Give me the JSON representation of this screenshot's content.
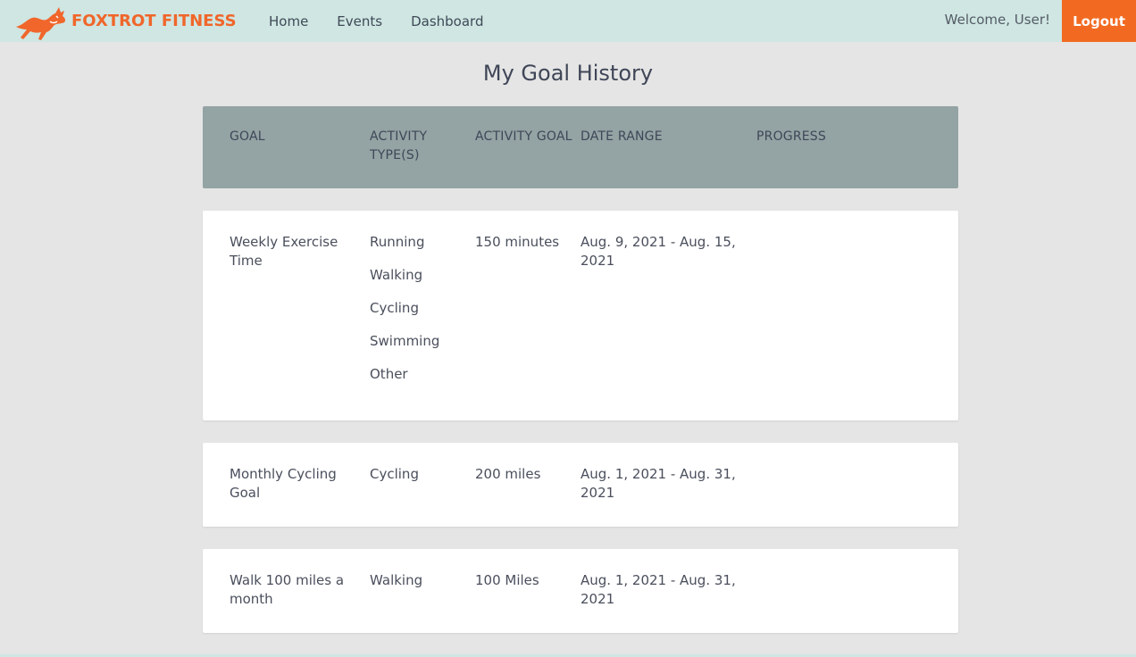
{
  "brand": {
    "name": "FOXTROT FITNESS",
    "logo": "fox-logo-icon",
    "color": "#f0662b"
  },
  "nav": {
    "links": [
      {
        "label": "Home"
      },
      {
        "label": "Events"
      },
      {
        "label": "Dashboard"
      }
    ],
    "welcome": "Welcome, User!",
    "logout_label": "Logout"
  },
  "page": {
    "title": "My Goal History"
  },
  "table": {
    "headers": {
      "goal": "GOAL",
      "type_line1": "ACTIVITY",
      "type_line2": "TYPE(S)",
      "activity_goal": "ACTIVITY GOAL",
      "date_range": "DATE RANGE",
      "progress": "PROGRESS"
    },
    "rows": [
      {
        "goal": "Weekly Exercise Time",
        "types": [
          "Running",
          "Walking",
          "Cycling",
          "Swimming",
          "Other"
        ],
        "activity_goal": "150 minutes",
        "date_range": "Aug. 9, 2021 - Aug. 15, 2021",
        "progress": ""
      },
      {
        "goal": "Monthly Cycling Goal",
        "types": [
          "Cycling"
        ],
        "activity_goal": "200 miles",
        "date_range": "Aug. 1, 2021 - Aug. 31, 2021",
        "progress": ""
      },
      {
        "goal": "Walk 100 miles a month",
        "types": [
          "Walking"
        ],
        "activity_goal": "100 Miles",
        "date_range": "Aug. 1, 2021 - Aug. 31, 2021",
        "progress": ""
      }
    ]
  },
  "colors": {
    "navbar_bg": "#cfe6e2",
    "accent": "#f26a21",
    "header_bg": "#94a3a3",
    "page_bg": "#e5e5e5"
  }
}
